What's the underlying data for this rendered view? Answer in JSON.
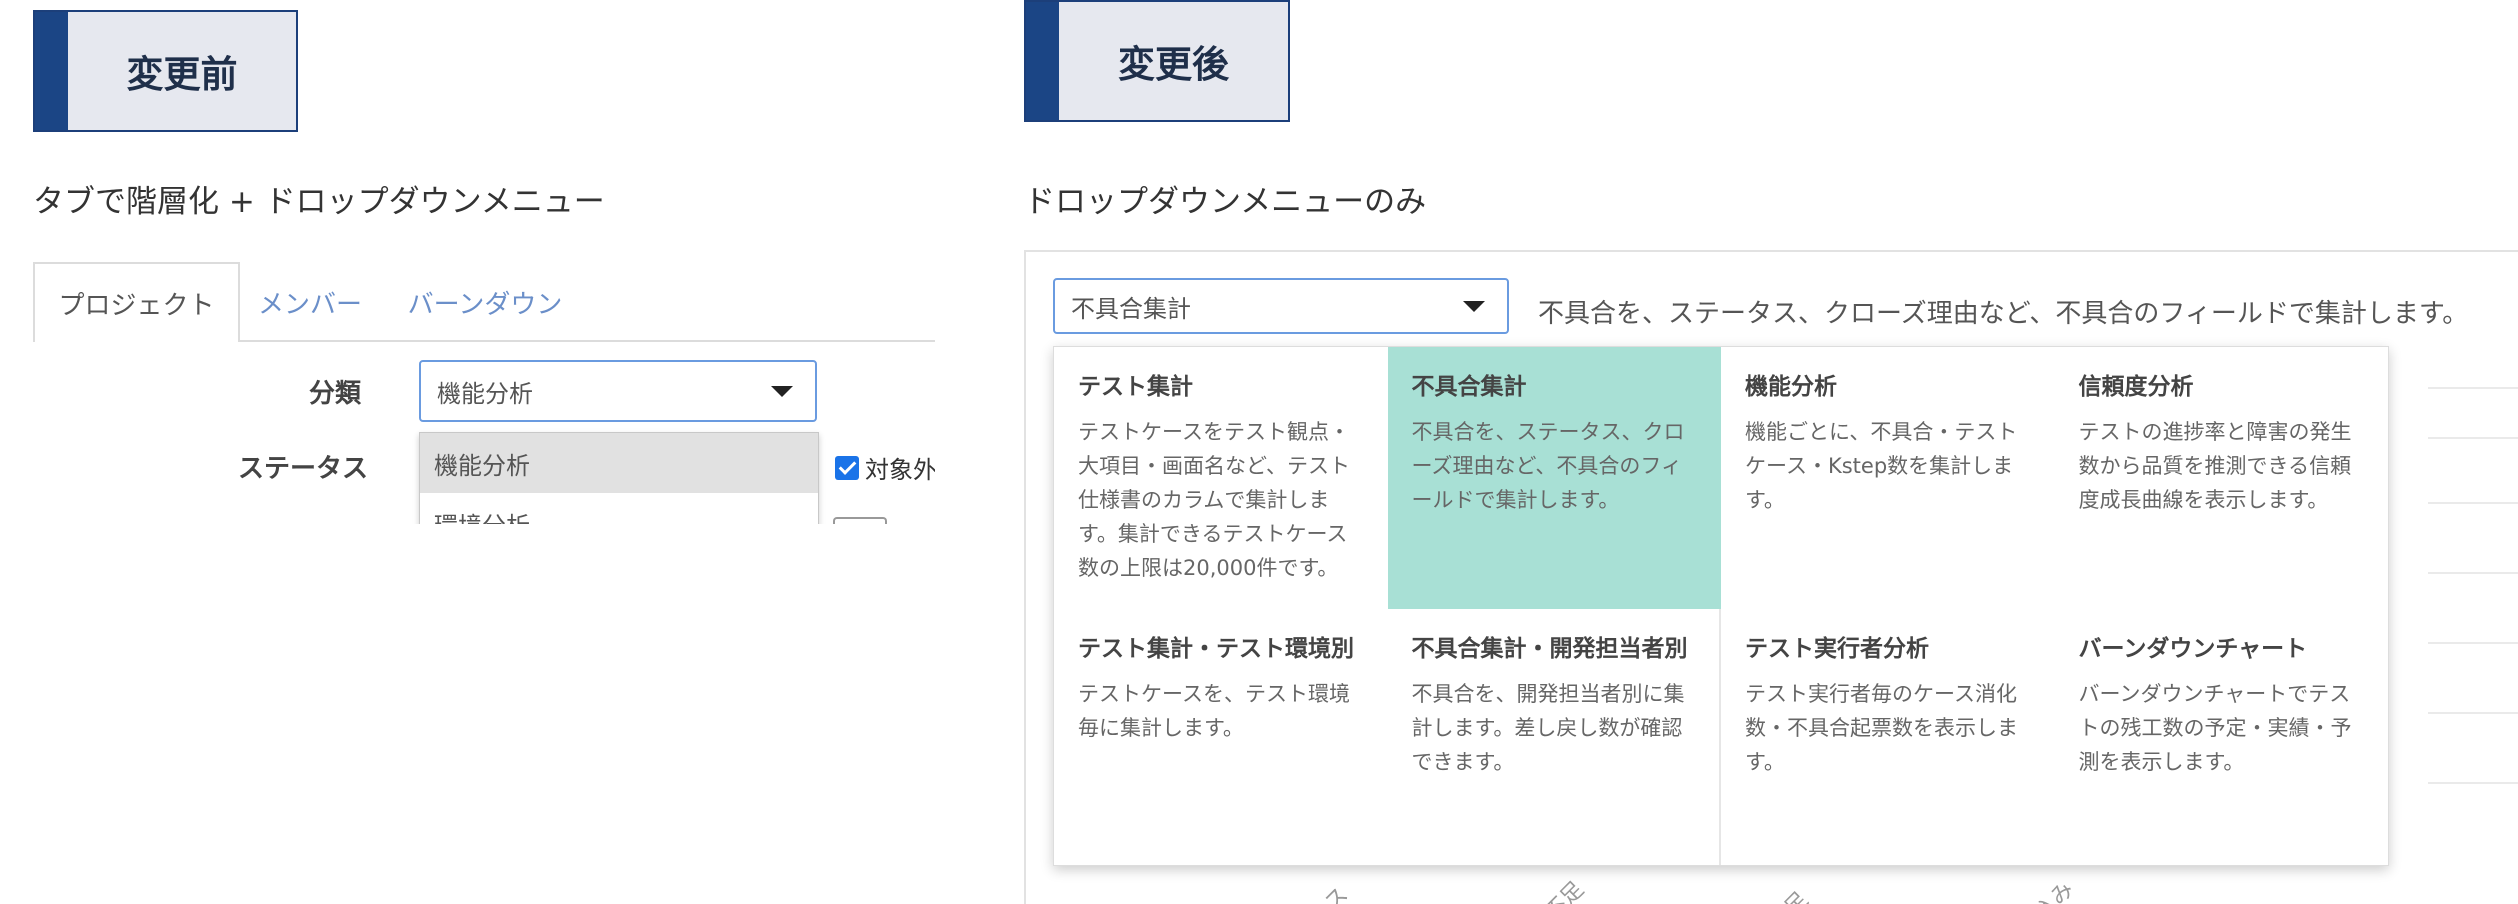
{
  "before": {
    "badge": "変更前",
    "subtitle": "タブで階層化 + ドロップダウンメニュー",
    "tabs": [
      "プロジェクト",
      "メンバー",
      "バーンダウン"
    ],
    "category_label": "分類",
    "status_label": "ステータス",
    "select_value": "機能分析",
    "menu_items": [
      "機能分析",
      "環境分析"
    ],
    "checkbox_label": "対象外"
  },
  "after": {
    "badge": "変更後",
    "subtitle": "ドロップダウンメニューのみ",
    "select_value": "不具合集計",
    "description": "不具合を、ステータス、クローズ理由など、不具合のフィールドで集計します。",
    "menu": [
      {
        "title": "テスト集計",
        "desc": "テストケースをテスト観点・大項目・画面名など、テスト仕様書のカラムで集計します。集計できるテストケース数の上限は20,000件です。"
      },
      {
        "title": "不具合集計",
        "desc": "不具合を、ステータス、クローズ理由など、不具合のフィールドで集計します。",
        "selected": true
      },
      {
        "title": "機能分析",
        "desc": "機能ごとに、不具合・テストケース・Kstep数を集計します。"
      },
      {
        "title": "信頼度分析",
        "desc": "テストの進捗率と障害の発生数から品質を推測できる信頼度成長曲線を表示します。"
      },
      {
        "title": "テスト集計・テスト環境別",
        "desc": "テストケースを、テスト環境毎に集計します。"
      },
      {
        "title": "不具合集計・開発担当者別",
        "desc": "不具合を、開発担当者別に集計します。差し戻し数が確認できます。"
      },
      {
        "title": "テスト実行者分析",
        "desc": "テスト実行者毎のケース消化数・不具合起票数を表示します。"
      },
      {
        "title": "バーンダウンチャート",
        "desc": "バーンダウンチャートでテストの残工数の予定・実績・予測を表示します。"
      }
    ],
    "axis_fragments": [
      "ス",
      "不足",
      "足",
      "込み"
    ]
  }
}
